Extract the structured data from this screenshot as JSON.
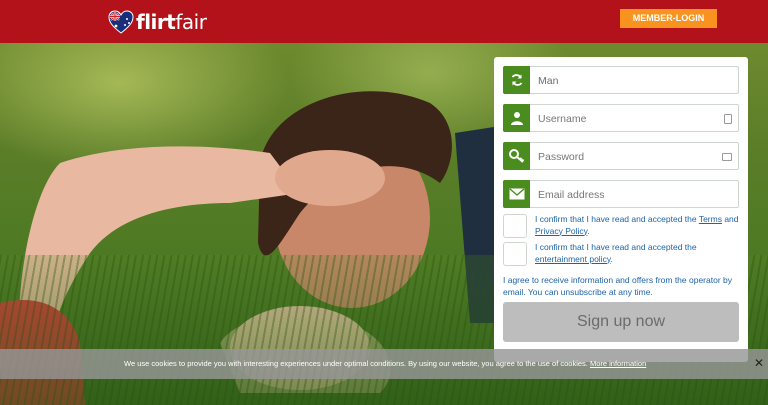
{
  "header": {
    "logo_bold": "flirt",
    "logo_thin": "fair",
    "member_login_label": "MEMBER-LOGIN",
    "background_color": "#b3121a",
    "button_color": "#f7931e"
  },
  "form": {
    "gender_value": "Man",
    "username_placeholder": "Username",
    "password_placeholder": "Password",
    "email_placeholder": "Email address",
    "terms_text_prefix": "I confirm that I have read and accepted the ",
    "terms_link": "Terms",
    "terms_and": " and ",
    "privacy_link": "Privacy Policy",
    "terms_suffix": ".",
    "entertainment_text_prefix": "I confirm that I have read and accepted the ",
    "entertainment_link": "entertainment policy",
    "entertainment_suffix": ".",
    "consent_text": "I agree to receive information and offers from the operator by email. You can unsubscribe at any time.",
    "signup_label": "Sign up now",
    "accent_color": "#4a8d1e",
    "icons": [
      "refresh-icon",
      "user-icon",
      "key-icon",
      "envelope-icon"
    ]
  },
  "cookie_bar": {
    "text": "We use cookies to provide you with interesting experiences under optimal conditions. By using our website, you agree to the use of cookies. ",
    "link": "More information",
    "close_symbol": "✕"
  }
}
